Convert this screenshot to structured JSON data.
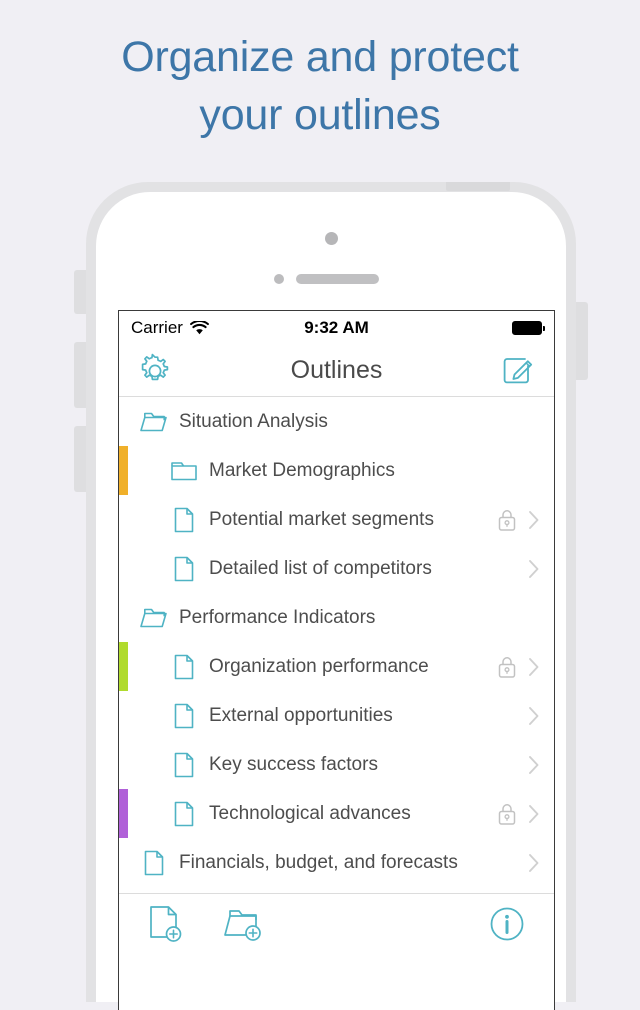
{
  "headline": {
    "line1": "Organize and protect",
    "line2": "your outlines",
    "color": "#3d76a8"
  },
  "theme": {
    "background": "#f0eff4",
    "accent_teal": "#4fb3c4",
    "text_gray": "#4d4d4d",
    "chevron_gray": "#d0d0d0",
    "lock_gray": "#c2c2c2"
  },
  "phone": {
    "status_bar": {
      "carrier": "Carrier",
      "wifi_icon": "wifi-icon",
      "time": "9:32 AM",
      "battery_icon": "battery-full-icon"
    },
    "nav_bar": {
      "settings_icon": "gear-icon",
      "title": "Outlines",
      "compose_icon": "compose-icon"
    },
    "list": [
      {
        "label": "Situation Analysis",
        "icon": "folder-open-icon",
        "indent": 0,
        "color_bar": null,
        "locked": false,
        "chevron": false
      },
      {
        "label": "Market Demographics",
        "icon": "folder-closed-icon",
        "indent": 1,
        "color_bar": "#f0b02a",
        "locked": false,
        "chevron": false
      },
      {
        "label": "Potential market segments",
        "icon": "document-icon",
        "indent": 1,
        "color_bar": null,
        "locked": true,
        "chevron": true
      },
      {
        "label": "Detailed list of competitors",
        "icon": "document-icon",
        "indent": 1,
        "color_bar": null,
        "locked": false,
        "chevron": true
      },
      {
        "label": "Performance Indicators",
        "icon": "folder-open-icon",
        "indent": 0,
        "color_bar": null,
        "locked": false,
        "chevron": false
      },
      {
        "label": "Organization performance",
        "icon": "document-icon",
        "indent": 1,
        "color_bar": "#b0db2d",
        "locked": true,
        "chevron": true
      },
      {
        "label": "External opportunities",
        "icon": "document-icon",
        "indent": 1,
        "color_bar": null,
        "locked": false,
        "chevron": true
      },
      {
        "label": "Key success factors",
        "icon": "document-icon",
        "indent": 1,
        "color_bar": null,
        "locked": false,
        "chevron": true
      },
      {
        "label": "Technological advances",
        "icon": "document-icon",
        "indent": 1,
        "color_bar": "#b060d8",
        "locked": true,
        "chevron": true
      },
      {
        "label": "Financials, budget, and forecasts",
        "icon": "document-icon",
        "indent": 0,
        "color_bar": null,
        "locked": false,
        "chevron": true
      }
    ],
    "toolbar": {
      "new_document_icon": "new-document-icon",
      "new_folder_icon": "new-folder-icon",
      "info_icon": "info-icon"
    }
  }
}
